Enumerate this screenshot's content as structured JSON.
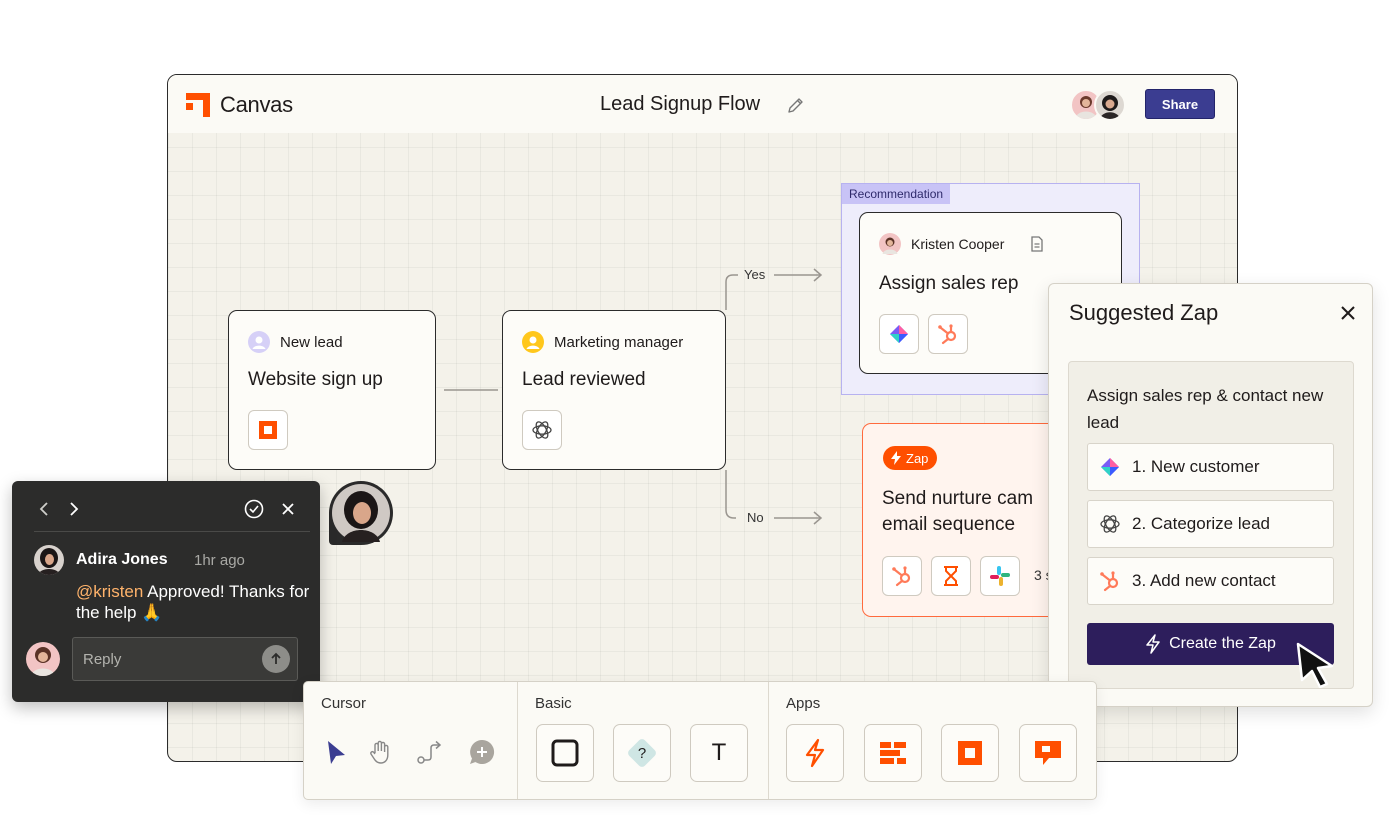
{
  "app": {
    "brand": "Canvas",
    "doc_title": "Lead Signup Flow",
    "share_label": "Share",
    "accent": "#ff4f00",
    "share_color": "#3b3d91"
  },
  "flow": {
    "card1": {
      "meta": "New lead",
      "title": "Website sign up",
      "icon": "person-icon",
      "app": "square-app-icon"
    },
    "card2": {
      "meta": "Marketing manager",
      "title": "Lead reviewed",
      "icon": "person-icon",
      "app": "openai-icon"
    },
    "recommendation": {
      "tag": "Recommendation",
      "author": "Kristen Cooper",
      "title": "Assign sales rep",
      "apps": [
        "diamond-app-icon",
        "hubspot-icon"
      ]
    },
    "branches": {
      "yes": "Yes",
      "no": "No"
    },
    "zap_card": {
      "badge": "Zap",
      "title_line1": "Send nurture cam",
      "title_line2": "email sequence",
      "more": "3 s",
      "apps": [
        "hubspot-icon",
        "hourglass-icon",
        "slack-icon"
      ]
    }
  },
  "suggested_zap": {
    "title": "Suggested Zap",
    "description": "Assign sales rep & contact new lead",
    "steps": [
      {
        "label": "1. New customer",
        "icon": "diamond-app-icon"
      },
      {
        "label": "2. Categorize lead",
        "icon": "openai-icon"
      },
      {
        "label": "3. Add new contact",
        "icon": "hubspot-icon"
      }
    ],
    "cta": "Create the Zap",
    "cta_color": "#2d1e5c"
  },
  "comment": {
    "author": "Adira Jones",
    "time": "1hr ago",
    "mention": "@kristen",
    "message": " Approved! Thanks for the help 🙏",
    "reply_placeholder": "Reply"
  },
  "toolbar": {
    "sections": [
      "Cursor",
      "Basic",
      "Apps"
    ],
    "cursor_tools": [
      "pointer-icon",
      "hand-icon",
      "path-icon",
      "add-comment-icon"
    ],
    "basic_tools": [
      "square-shape-icon",
      "decision-diamond-icon",
      "text-icon"
    ],
    "basic_decision_glyph": "?",
    "basic_text_glyph": "T",
    "app_tools": [
      "zap-bolt-icon",
      "interfaces-icon",
      "square-app-icon",
      "chatbot-icon"
    ]
  }
}
